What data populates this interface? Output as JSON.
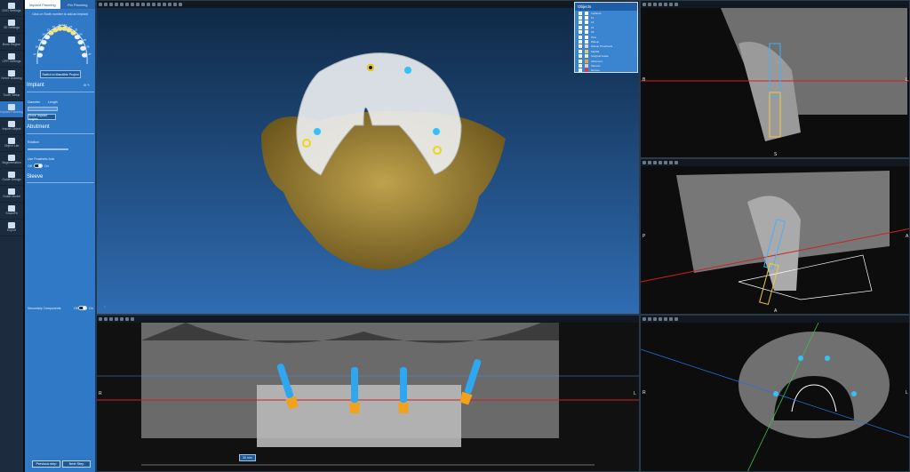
{
  "toolbar": {
    "items": [
      {
        "label": "DVD Settings",
        "icon": "disc-icon",
        "active": false
      },
      {
        "label": "3D Settings",
        "icon": "cube-icon",
        "active": false
      },
      {
        "label": "Bone Region",
        "icon": "bone-icon",
        "active": false
      },
      {
        "label": "CPR Settings",
        "icon": "curve-icon",
        "active": false
      },
      {
        "label": "Nerve Drawing",
        "icon": "nerve-icon",
        "active": false
      },
      {
        "label": "Tooth Setup",
        "icon": "tooth-icon",
        "active": false
      },
      {
        "label": "Implant Planning",
        "icon": "implant-icon",
        "active": true
      },
      {
        "label": "Import Object",
        "icon": "import-icon",
        "active": false
      },
      {
        "label": "Object List",
        "icon": "list-icon",
        "active": false
      },
      {
        "label": "Segmentation",
        "icon": "segment-icon",
        "active": false
      },
      {
        "label": "Guide Design",
        "icon": "guide-icon",
        "active": false
      },
      {
        "label": "Guide Model",
        "icon": "model-icon",
        "active": false
      },
      {
        "label": "SmartFit",
        "icon": "smartfit-icon",
        "active": false
      },
      {
        "label": "Export",
        "icon": "export-icon",
        "active": false
      }
    ]
  },
  "panel": {
    "tabs": [
      "Implant Planning",
      "Pin Planning"
    ],
    "hint": "Click on Tooth number to add an Implant",
    "switch_button": "Switch to Mandible Project",
    "implant_title": "Implant",
    "diameter_label": "Diameter",
    "length_label": "Length",
    "angles_button": "Show Implant Angles",
    "abutment_title": "Abutment",
    "rotation_label": "Rotation",
    "prosthetic_label": "Use Prosthetic Axis",
    "toggle_off": "Off",
    "toggle_on": "On",
    "sleeve_title": "Sleeve",
    "secondary_label": "Secondary Components",
    "previous_button": "Previous step",
    "next_button": "Next Step",
    "teeth_upper": [
      "17",
      "16",
      "15",
      "14",
      "13",
      "12",
      "11",
      "21",
      "22",
      "23",
      "24",
      "25",
      "26",
      "27"
    ],
    "teeth_side_right": [
      "18",
      "17",
      "16"
    ],
    "teeth_side_left": [
      "28",
      "27",
      "26"
    ]
  },
  "objects_window": {
    "title": "Objects",
    "rows": [
      "Implants",
      "11",
      "13",
      "21",
      "23",
      "Pins",
      "Waxup",
      "Waxup Prosthesis",
      "Maxilla",
      "Surgical Guide",
      "Abutment",
      "Sleeves",
      "Nerves"
    ],
    "colors": [
      "#ffffff",
      "#ffffff",
      "#ffffff",
      "#ffffff",
      "#ffffff",
      "#ffffff",
      "#f1f1f1",
      "#d9d9d9",
      "#e0c870",
      "#f3e7c2",
      "#e8a63a",
      "#d0d0d0",
      "#e23a3a"
    ]
  },
  "viewports": {
    "axial_labels": {
      "top": "S",
      "bottom": "A",
      "left": "R",
      "right": "L"
    },
    "panoramic_labels": {
      "left": "R",
      "right": "L"
    },
    "sagittal_labels": {
      "left": "B",
      "right": "L",
      "bottom": "S"
    },
    "coronal_labels": {
      "left": "P",
      "right": "A",
      "bottom": "A"
    },
    "crosssection_labels": {
      "left": "R",
      "right": "L"
    },
    "zoom": "30 mm"
  },
  "colors": {
    "accent": "#2f79c7",
    "implant_blue": "#2ea6f0",
    "abutment_gold": "#f2a21a"
  }
}
